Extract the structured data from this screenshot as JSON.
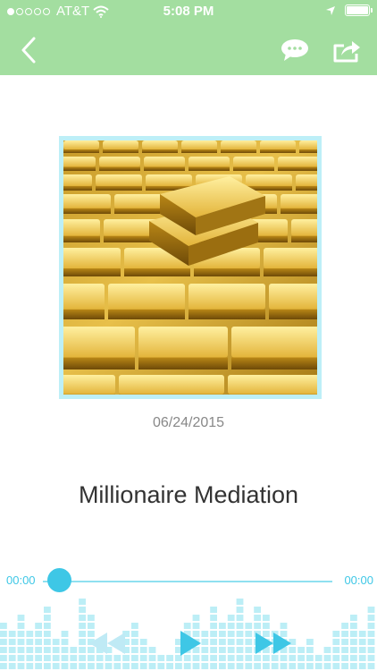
{
  "status_bar": {
    "carrier": "AT&T",
    "time": "5:08 PM",
    "signal_bars_filled": 1,
    "signal_bars_total": 5
  },
  "nav": {
    "back_icon": "chevron-left-icon",
    "comment_icon": "speech-bubble-icon",
    "share_icon": "share-icon"
  },
  "episode": {
    "artwork": "gold-bars-image",
    "date": "06/24/2015",
    "title": "Millionaire Mediation"
  },
  "player": {
    "elapsed": "00:00",
    "duration": "00:00",
    "progress": 0,
    "controls": [
      "rewind-icon",
      "play-icon",
      "fast-forward-icon"
    ]
  },
  "colors": {
    "header_green": "#a3dea0",
    "accent_cyan": "#3ec7e6",
    "frame_cyan": "#bdeff7",
    "equalizer": "#b5ecf5"
  }
}
